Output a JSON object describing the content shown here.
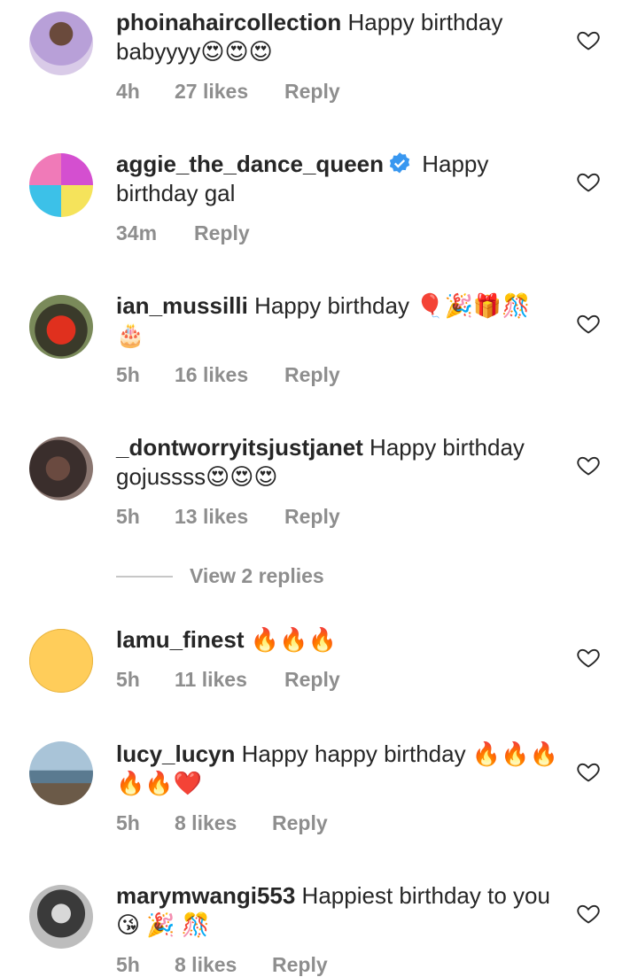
{
  "comments": [
    {
      "username": "phoinahaircollection",
      "text": " Happy birthday babyyyy😍😍😍",
      "time": "4h",
      "likes": "27 likes",
      "reply": "Reply",
      "verified": false
    },
    {
      "username": "aggie_the_dance_queen",
      "text": " Happy birthday gal",
      "time": "34m",
      "likes": "",
      "reply": "Reply",
      "verified": true
    },
    {
      "username": "ian_mussilli",
      "text": " Happy birthday 🎈🎉🎁🎊🎂",
      "time": "5h",
      "likes": "16 likes",
      "reply": "Reply",
      "verified": false
    },
    {
      "username": "_dontworryitsjustjanet",
      "text": " Happy birthday gojussss😍😍😍",
      "time": "5h",
      "likes": "13 likes",
      "reply": "Reply",
      "verified": false
    },
    {
      "username": "lamu_finest",
      "text": " 🔥🔥🔥",
      "time": "5h",
      "likes": "11 likes",
      "reply": "Reply",
      "verified": false
    },
    {
      "username": "lucy_lucyn",
      "text": " Happy happy birthday 🔥🔥🔥🔥🔥❤️",
      "time": "5h",
      "likes": "8 likes",
      "reply": "Reply",
      "verified": false
    },
    {
      "username": "marymwangi553",
      "text": " Happiest birthday to you 😘 🎉 🎊",
      "time": "5h",
      "likes": "8 likes",
      "reply": "Reply",
      "verified": false
    }
  ],
  "view_replies": "View 2 replies",
  "colors": {
    "text": "#262626",
    "muted": "#8e8e8e",
    "verified": "#3897f0",
    "divider": "#c7c7c7",
    "avatar_yellow": "#ffcd5a"
  }
}
